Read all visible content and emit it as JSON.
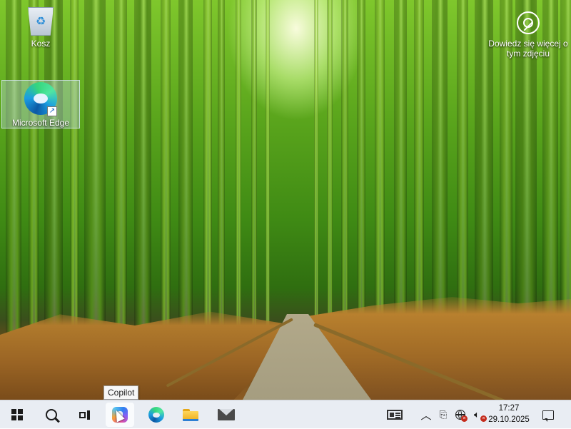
{
  "desktop": {
    "icons": [
      {
        "label": "Kosz",
        "icon": "recycle-bin-icon"
      },
      {
        "label": "Microsoft Edge",
        "icon": "edge-icon"
      }
    ],
    "learn_more": {
      "label": "Dowiedz się więcej o tym zdjęciu",
      "icon": "learn-more-icon"
    }
  },
  "tooltip": {
    "text": "Copilot"
  },
  "taskbar": {
    "apps": [
      {
        "name": "Start",
        "icon": "windows-icon"
      },
      {
        "name": "Search",
        "icon": "search-icon"
      },
      {
        "name": "Task View",
        "icon": "task-view-icon"
      },
      {
        "name": "Copilot",
        "icon": "copilot-icon"
      },
      {
        "name": "Microsoft Edge",
        "icon": "edge-icon"
      },
      {
        "name": "File Explorer",
        "icon": "folder-icon"
      },
      {
        "name": "Mail",
        "icon": "mail-icon"
      }
    ],
    "tray": {
      "time": "17:27",
      "date": "29.10.2025",
      "icons": [
        "widgets-icon",
        "chevron-up-icon",
        "meet-icon",
        "network-icon",
        "speaker-icon",
        "notification-icon"
      ]
    }
  },
  "colors": {
    "taskbar_bg": "#e9edf3",
    "edge_blue": "#1b9de2",
    "edge_green": "#36d67c",
    "alert_red": "#c42b1c"
  }
}
